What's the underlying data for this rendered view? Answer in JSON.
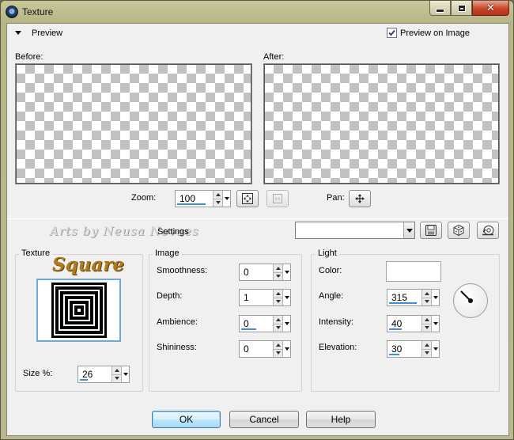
{
  "window": {
    "title": "Texture"
  },
  "preview_section": {
    "header": "Preview",
    "preview_on_image_label": "Preview on Image",
    "preview_on_image_checked": true,
    "before_label": "Before:",
    "after_label": "After:",
    "zoom_label": "Zoom:",
    "zoom_value": "100",
    "pan_label": "Pan:"
  },
  "settings": {
    "watermark": "Arts by Neusa Novaes",
    "label": "Settings",
    "preset_value": ""
  },
  "texture_group": {
    "label": "Texture",
    "logo_text": "Square",
    "size_label": "Size %:",
    "size_value": "26",
    "size_fraction": 0.26
  },
  "image_group": {
    "label": "Image",
    "fields": [
      {
        "label": "Smoothness:",
        "value": "0",
        "fraction": 0
      },
      {
        "label": "Depth:",
        "value": "1",
        "fraction": 0.01
      },
      {
        "label": "Ambience:",
        "value": "0",
        "fraction": 0.5
      },
      {
        "label": "Shininess:",
        "value": "0",
        "fraction": 0
      }
    ]
  },
  "light_group": {
    "label": "Light",
    "color_label": "Color:",
    "color_value": "#ffffff",
    "angle_label": "Angle:",
    "angle_value": "315",
    "angle_fraction": 0.875,
    "intensity_label": "Intensity:",
    "intensity_value": "40",
    "intensity_fraction": 0.4,
    "elevation_label": "Elevation:",
    "elevation_value": "30",
    "elevation_fraction": 0.33
  },
  "buttons": {
    "ok": "OK",
    "cancel": "Cancel",
    "help": "Help"
  },
  "colors": {
    "accent": "#3d8ee0",
    "logo_gold": "#b07a1c",
    "title_bar": "#b7b585"
  }
}
